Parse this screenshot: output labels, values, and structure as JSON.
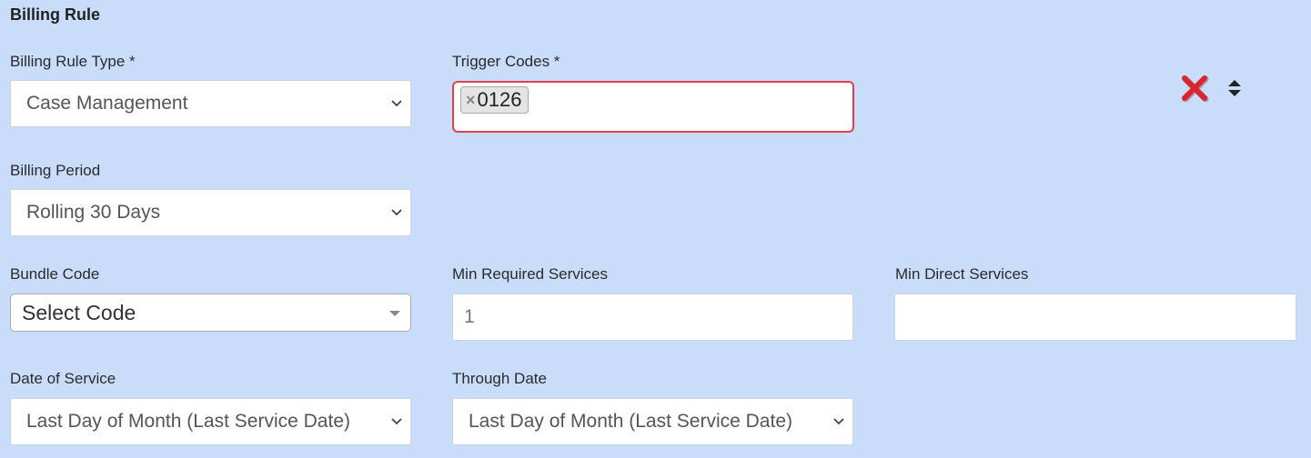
{
  "section": {
    "title": "Billing Rule"
  },
  "billing_rule_type": {
    "label": "Billing Rule Type *",
    "value": "Case Management"
  },
  "trigger_codes": {
    "label": "Trigger Codes *",
    "tags": [
      "0126"
    ],
    "tag_remove_glyph": "×",
    "error_border_color": "#e3404f"
  },
  "actions": {
    "delete_icon": "red-x-icon",
    "sort_icon": "sort-updown-icon"
  },
  "billing_period": {
    "label": "Billing Period",
    "value": "Rolling 30 Days"
  },
  "bundle_code": {
    "label": "Bundle Code",
    "value": "Select Code"
  },
  "min_required_services": {
    "label": "Min Required Services",
    "value": "1"
  },
  "min_direct_services": {
    "label": "Min Direct Services",
    "value": ""
  },
  "date_of_service": {
    "label": "Date of Service",
    "value": "Last Day of Month (Last Service Date)"
  },
  "through_date": {
    "label": "Through Date",
    "value": "Last Day of Month (Last Service Date)"
  },
  "colors": {
    "background": "#c9ddfa",
    "delete_red": "#d9252f"
  }
}
